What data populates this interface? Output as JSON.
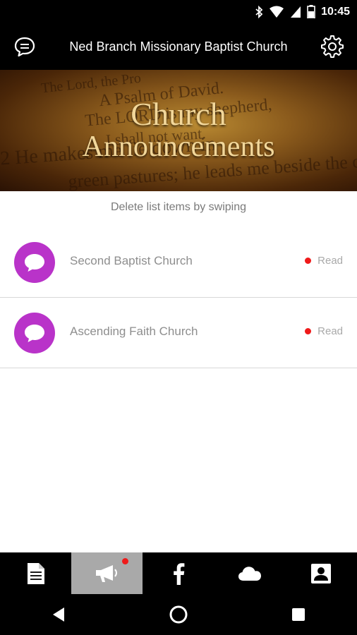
{
  "status_bar": {
    "time": "10:45"
  },
  "app_bar": {
    "title": "Ned Branch Missionary Baptist Church"
  },
  "banner": {
    "title_line1": "Church",
    "title_line2": "Announcements",
    "bg_line1": "The Lord, the Pro",
    "bg_line2": "A Psalm of David.",
    "bg_line3": "The LORD is my shepherd,",
    "bg_line4": "I shall not want.",
    "bg_line5": "2 He makes me lie down in",
    "bg_line6": "green pastures; he leads me beside the quiet"
  },
  "hint": "Delete list items by swiping",
  "items": [
    {
      "name": "Second Baptist Church",
      "status": "Read"
    },
    {
      "name": "Ascending Faith Church",
      "status": "Read"
    }
  ],
  "colors": {
    "accent": "#b933c9",
    "unread_dot": "#ef1a1a",
    "active_tab": "#a9a9a9"
  },
  "tabs": [
    {
      "icon": "document-icon"
    },
    {
      "icon": "megaphone-icon",
      "active": true,
      "badge": true
    },
    {
      "icon": "facebook-icon"
    },
    {
      "icon": "cloud-icon"
    },
    {
      "icon": "contact-icon"
    }
  ]
}
